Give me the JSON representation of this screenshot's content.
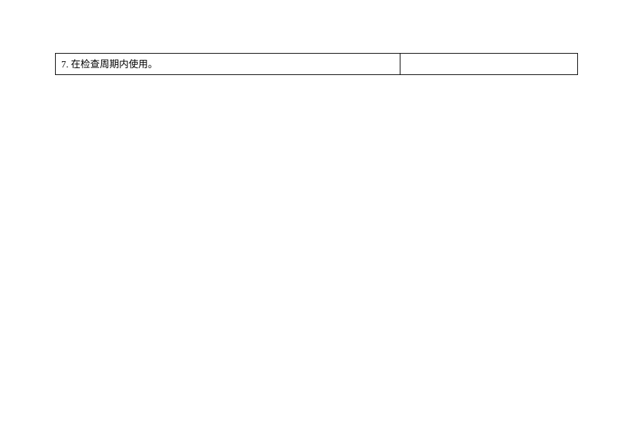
{
  "table": {
    "rows": [
      {
        "left": "7. 在检查周期内使用。",
        "right": ""
      }
    ]
  }
}
